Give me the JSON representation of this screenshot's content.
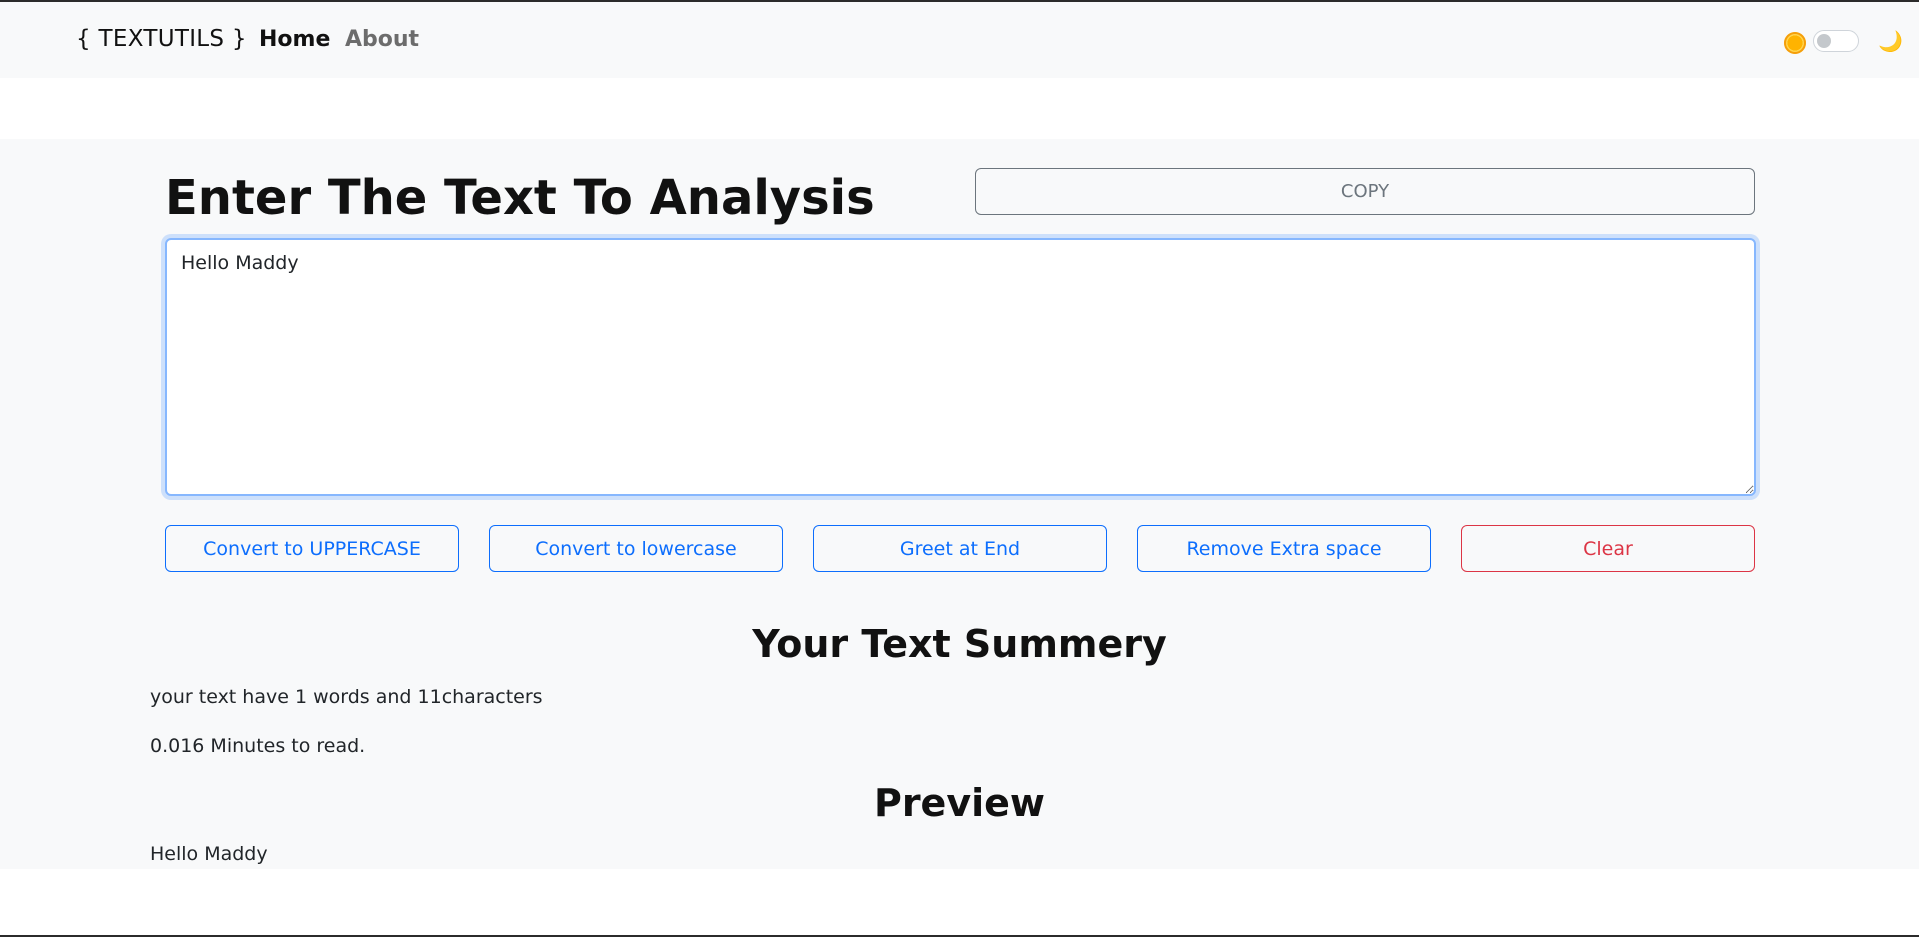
{
  "navbar": {
    "brand": "{ TEXTUTILS }",
    "links": [
      {
        "label": "Home"
      },
      {
        "label": "About"
      }
    ],
    "icons": {
      "left": "sun-icon",
      "right": "moon-icon"
    },
    "toggle_on": false
  },
  "main": {
    "heading": "Enter The Text To Analysis",
    "copy_label": "COPY",
    "textarea_value": "Hello Maddy",
    "buttons": [
      {
        "label": "Convert to UPPERCASE",
        "variant": "primary"
      },
      {
        "label": "Convert to lowercase",
        "variant": "primary"
      },
      {
        "label": "Greet at End",
        "variant": "primary"
      },
      {
        "label": "Remove Extra space",
        "variant": "primary"
      },
      {
        "label": "Clear",
        "variant": "danger"
      }
    ]
  },
  "summary": {
    "heading": "Your Text Summery",
    "counts": "your text have 1 words and 11characters",
    "read_time": "0.016 Minutes to read."
  },
  "preview": {
    "heading": "Preview",
    "text": "Hello Maddy"
  },
  "colors": {
    "primary": "#0d6efd",
    "danger": "#dc3545",
    "background": "#f8f9fa"
  }
}
